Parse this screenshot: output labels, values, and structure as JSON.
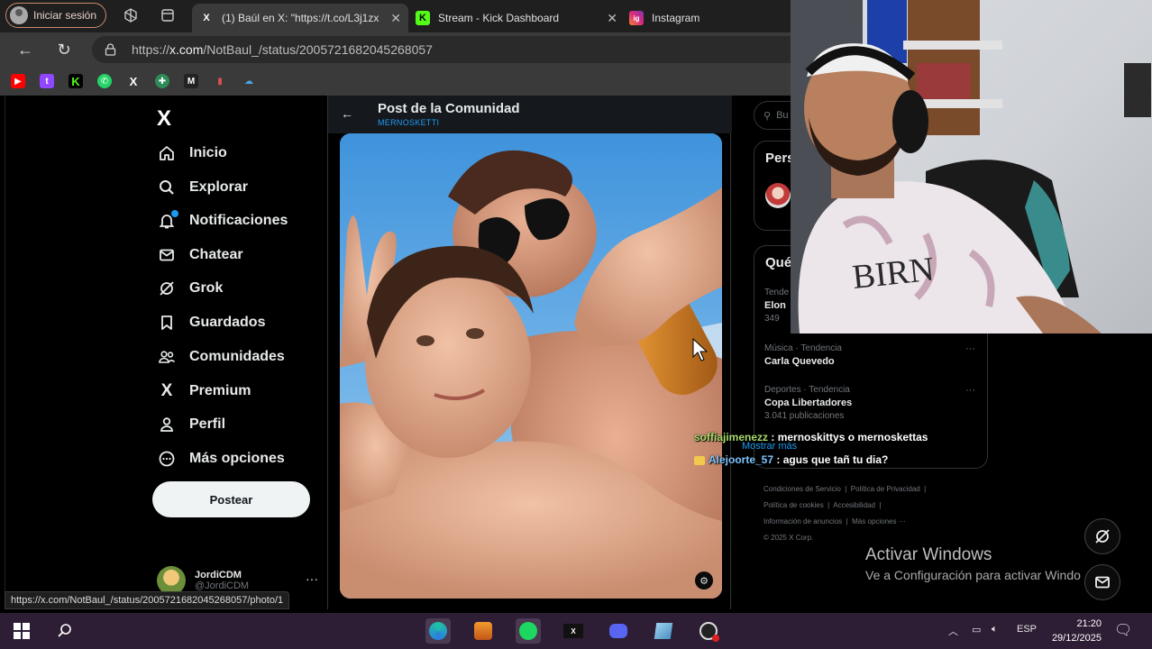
{
  "browser": {
    "signin_label": "Iniciar sesión",
    "tabs": [
      {
        "title": "(1) Baúl en X: \"https://t.co/L3j1zx",
        "favicon": "X",
        "active": true
      },
      {
        "title": "Stream - Kick Dashboard",
        "favicon": "K",
        "active": false
      },
      {
        "title": "Instagram",
        "favicon": "ig",
        "active": false
      }
    ],
    "url_prefix": "https://",
    "url_domain": "x.com",
    "url_path": "/NotBaul_/status/2005721682045268057",
    "status_link": "https://x.com/NotBaul_/status/2005721682045268057/photo/1"
  },
  "x_nav": {
    "logo": "X",
    "items": [
      {
        "label": "Inicio",
        "icon": "home-icon"
      },
      {
        "label": "Explorar",
        "icon": "search-icon"
      },
      {
        "label": "Notificaciones",
        "icon": "bell-icon"
      },
      {
        "label": "Chatear",
        "icon": "mail-icon"
      },
      {
        "label": "Grok",
        "icon": "grok-icon"
      },
      {
        "label": "Guardados",
        "icon": "bookmark-icon"
      },
      {
        "label": "Comunidades",
        "icon": "people-icon"
      },
      {
        "label": "Premium",
        "icon": "x-icon"
      },
      {
        "label": "Perfil",
        "icon": "person-icon"
      },
      {
        "label": "Más opciones",
        "icon": "more-circle-icon"
      }
    ],
    "post_button": "Postear",
    "account_name": "JordiCDM",
    "account_handle": "@JordiCDM"
  },
  "post": {
    "title": "Post de la Comunidad",
    "community": "MERNOSKETTI"
  },
  "sidebar": {
    "search_placeholder": "Bu",
    "persons_heading": "Pers",
    "trends_heading": "Qué",
    "trends": [
      {
        "category": "Tende",
        "title": "Elon",
        "count": "349"
      },
      {
        "category": "Música · Tendencia",
        "title": "Carla Quevedo",
        "count": ""
      },
      {
        "category": "Deportes · Tendencia",
        "title": "Copa Libertadores",
        "count": "3.041 publicaciones"
      }
    ],
    "show_more": "Mostrar más",
    "footer": [
      "Condiciones de Servicio",
      "Política de Privacidad",
      "Política de cookies",
      "Accesibilidad",
      "Información de anuncios",
      "Más opciones ···",
      "© 2025 X Corp."
    ]
  },
  "chat": [
    {
      "user": "soffiajimenezz",
      "message": " : mernoskittys o mernoskettas"
    },
    {
      "user": "Alejoorte_57",
      "message": " : agus que tañ tu dia?"
    }
  ],
  "watermark": {
    "line1": "Activar Windows",
    "line2": "Ve a Configuración para activar Windo"
  },
  "taskbar": {
    "language": "ESP",
    "time": "21:20",
    "date": "29/12/2025"
  }
}
